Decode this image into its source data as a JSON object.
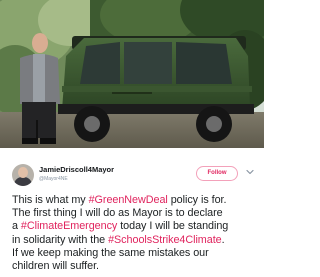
{
  "photo": {
    "description_icon": "photo"
  },
  "tweet": {
    "author_name": "JamieDriscoll4Mayor",
    "author_handle": "@Mayor4NE",
    "follow_label": "Follow",
    "lines": [
      [
        "This is what my ",
        "#GreenNewDeal",
        " policy is for."
      ],
      [
        "The first thing I will do as Mayor is to declare"
      ],
      [
        "a ",
        "#ClimateEmergency",
        " today I will be standing"
      ],
      [
        "in solidarity with the ",
        "#SchoolsStrike4Climate",
        "."
      ],
      [
        "If we keep making the same mistakes our"
      ],
      [
        "children will suffer."
      ]
    ]
  },
  "colors": {
    "hashtag": "#e0245e",
    "text": "#1c2022",
    "follow": "#e0245e"
  }
}
